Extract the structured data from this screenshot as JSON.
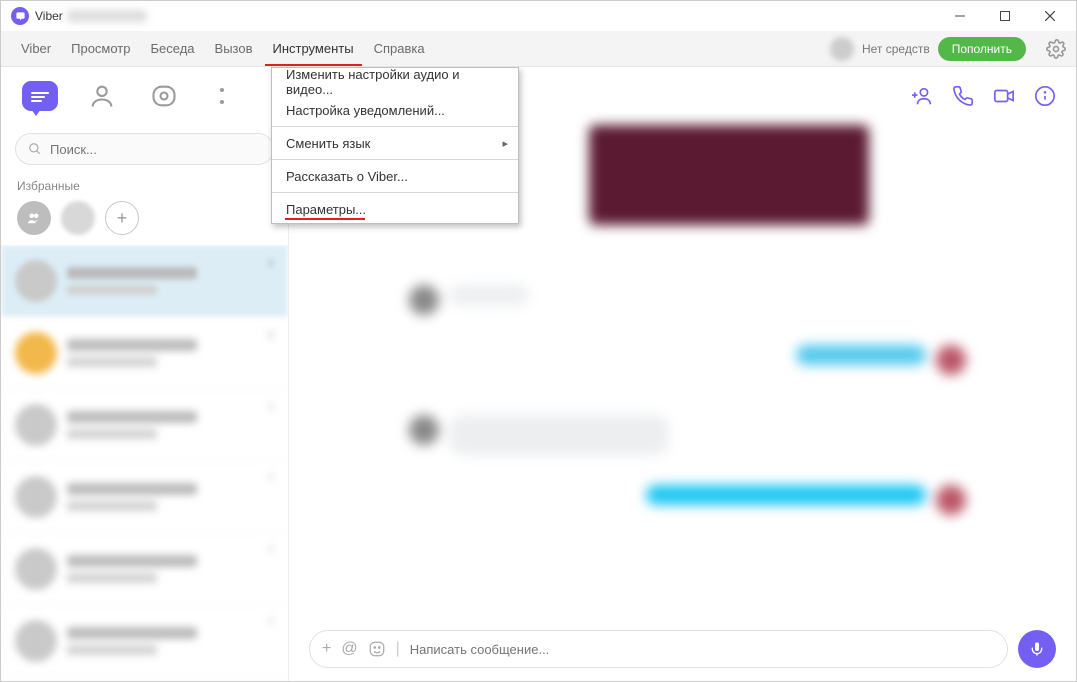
{
  "titlebar": {
    "app_name": "Viber"
  },
  "menubar": {
    "items": [
      "Viber",
      "Просмотр",
      "Беседа",
      "Вызов",
      "Инструменты",
      "Справка"
    ],
    "active_index": 4,
    "balance_label": "Нет средств",
    "topup_label": "Пополнить"
  },
  "dropdown": {
    "items": [
      {
        "label": "Изменить настройки аудио и видео...",
        "type": "item"
      },
      {
        "label": "Настройка уведомлений...",
        "type": "item"
      },
      {
        "type": "sep"
      },
      {
        "label": "Сменить язык",
        "type": "submenu"
      },
      {
        "type": "sep"
      },
      {
        "label": "Рассказать о Viber...",
        "type": "item"
      },
      {
        "type": "sep"
      },
      {
        "label": "Параметры...",
        "type": "highlighted"
      }
    ]
  },
  "sidebar": {
    "search_placeholder": "Поиск...",
    "favorites_label": "Избранные",
    "chat_times": [
      "в",
      "в",
      "к",
      "7",
      "7",
      "7"
    ]
  },
  "composer": {
    "placeholder": "Написать сообщение..."
  }
}
